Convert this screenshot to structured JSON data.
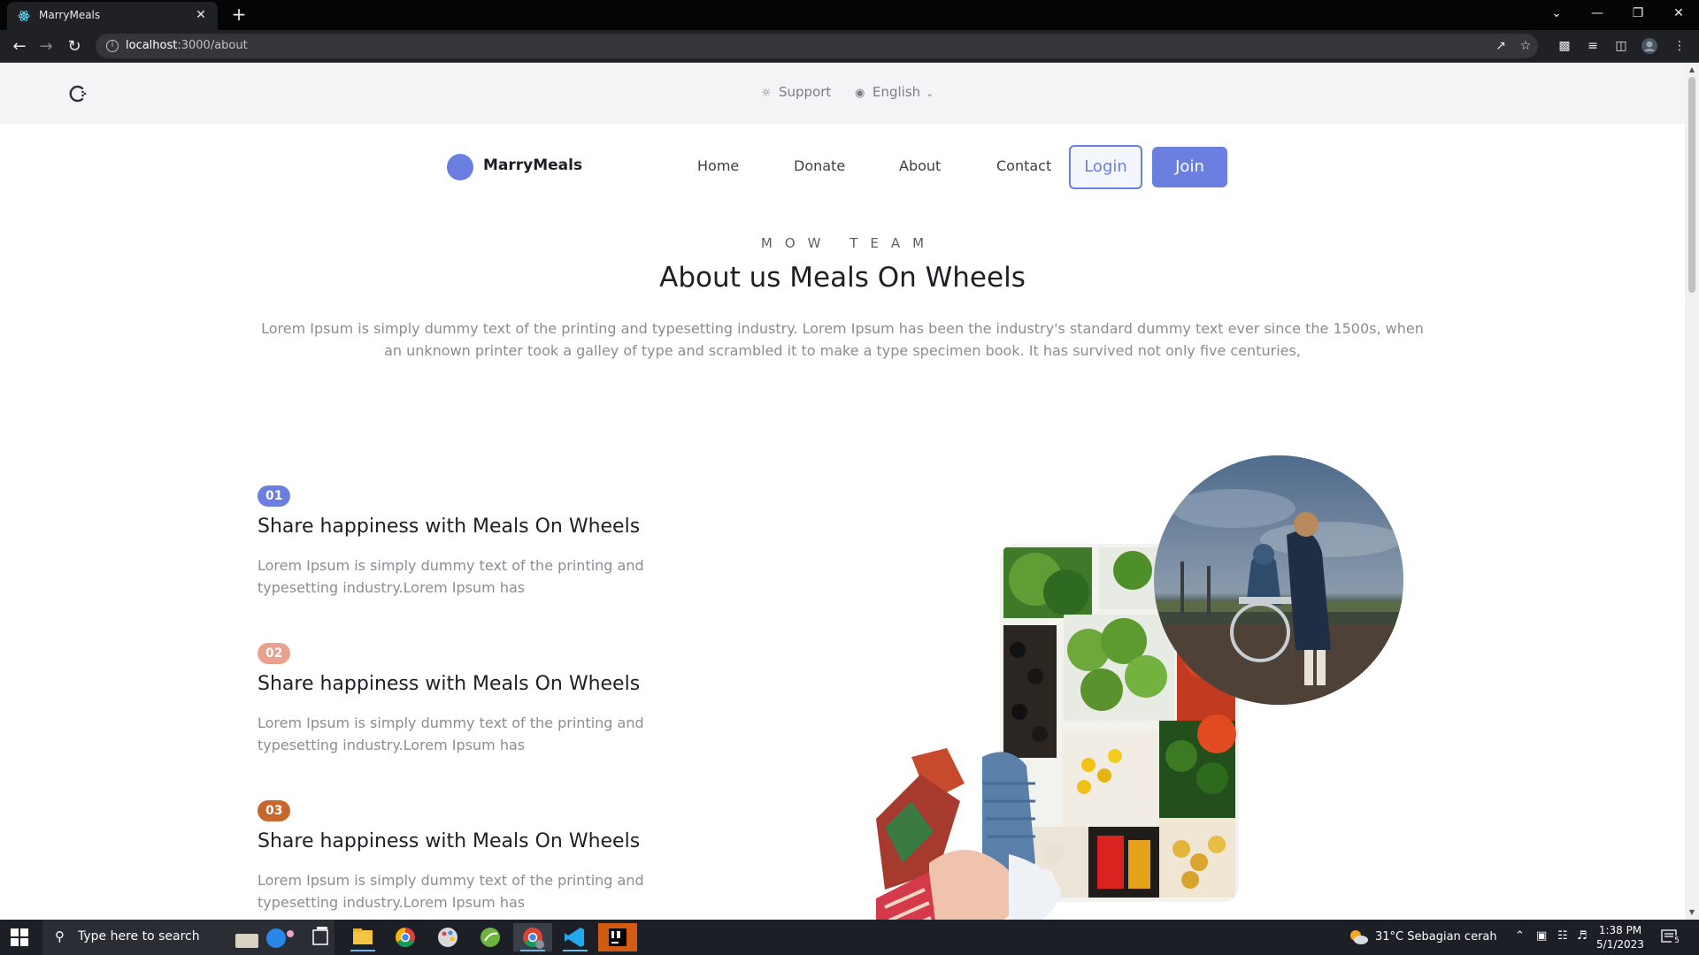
{
  "browser": {
    "tab_title": "MarryMeals",
    "tab_close": "✕",
    "new_tab": "+",
    "url_host": "localhost",
    "url_rest": ":3000/about",
    "window_controls": {
      "tab_search": "⌄",
      "minimize": "—",
      "restore": "❐",
      "close": "✕"
    }
  },
  "topbar": {
    "support_label": "Support",
    "language_label": "English"
  },
  "navbar": {
    "brand": "MarryMeals",
    "links": [
      "Home",
      "Donate",
      "About",
      "Contact"
    ],
    "login_label": "Login",
    "join_label": "Join",
    "accent": "#6a7fe0"
  },
  "hero": {
    "eyebrow": "MOW TEAM",
    "title": "About us Meals On Wheels",
    "description": "Lorem Ipsum is simply dummy text of the printing and typesetting industry. Lorem Ipsum has been the industry's standard dummy text ever since the 1500s, when an unknown printer took a galley of type and scrambled it to make a type specimen book. It has survived not only five centuries,"
  },
  "features": [
    {
      "number": "01",
      "badge_color": "#6a7fe0",
      "title": "Share happiness with Meals On Wheels",
      "text": "Lorem Ipsum is simply dummy text of the printing and typesetting industry.Lorem Ipsum has"
    },
    {
      "number": "02",
      "badge_color": "#e9a08f",
      "title": "Share happiness with Meals On Wheels",
      "text": "Lorem Ipsum is simply dummy text of the printing and typesetting industry.Lorem Ipsum has"
    },
    {
      "number": "03",
      "badge_color": "#c7672c",
      "title": "Share happiness with Meals On Wheels",
      "text": "Lorem Ipsum is simply dummy text of the printing and typesetting industry.Lorem Ipsum has"
    }
  ],
  "taskbar": {
    "search_placeholder": "Type here to search",
    "weather": "31°C  Sebagian cerah",
    "time": "1:38 PM",
    "date": "5/1/2023",
    "notification_count": "5"
  }
}
